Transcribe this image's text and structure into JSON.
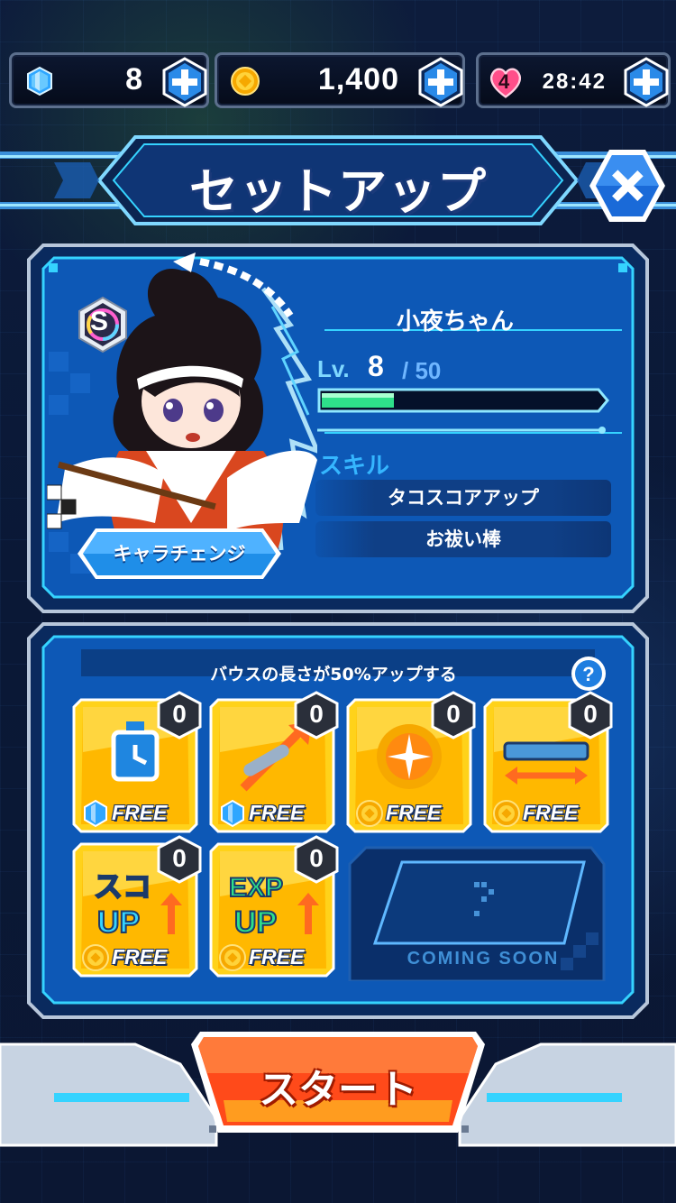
{
  "resources": {
    "gems": "8",
    "coins": "1,400",
    "hearts_count": "4",
    "timer": "28:42"
  },
  "header": {
    "title": "セットアップ"
  },
  "character": {
    "name": "小夜ちゃん",
    "rank": "S",
    "level_label": "Lv.",
    "level": "8",
    "level_max": "/ 50",
    "exp_progress": 0.26,
    "skill_title": "スキル",
    "skills": [
      "タコスコアアップ",
      "お祓い棒"
    ],
    "change_button": "キャラチェンジ"
  },
  "items": {
    "description": "バウスの長さが50%アップする",
    "list": [
      {
        "name": "time-boost",
        "quantity": "0",
        "cost_type": "gem",
        "cost_label": "FREE"
      },
      {
        "name": "bat-boost",
        "quantity": "0",
        "cost_type": "gem",
        "cost_label": "FREE"
      },
      {
        "name": "power-boost",
        "quantity": "0",
        "cost_type": "coin",
        "cost_label": "FREE"
      },
      {
        "name": "length-boost",
        "quantity": "0",
        "cost_type": "coin",
        "cost_label": "FREE"
      },
      {
        "name": "score-up",
        "quantity": "0",
        "cost_type": "coin",
        "cost_label": "FREE",
        "art_text": "スコアUP"
      },
      {
        "name": "exp-up",
        "quantity": "0",
        "cost_type": "coin",
        "cost_label": "FREE",
        "art_text": "EXP UP"
      }
    ],
    "coming_soon": "COMING SOON"
  },
  "start": {
    "label": "スタート"
  },
  "colors": {
    "accent_cyan": "#35d3ff",
    "panel_blue": "#0c4fa8",
    "gold": "#ffcc1a",
    "start_red": "#ff3d1a"
  }
}
